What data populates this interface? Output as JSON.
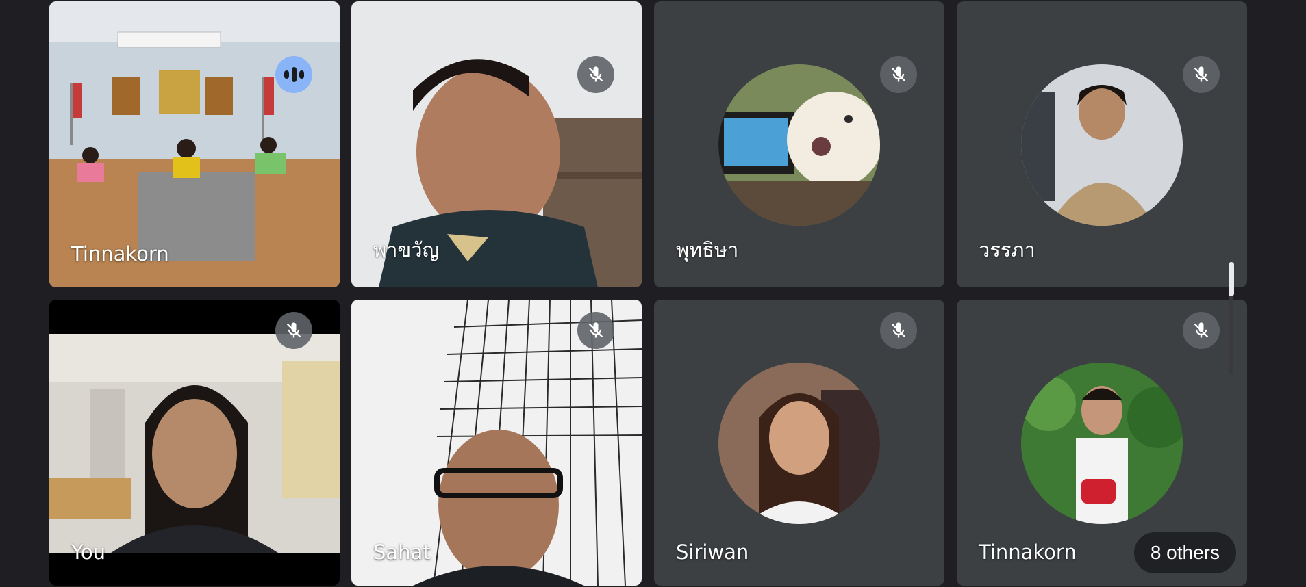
{
  "participants": [
    {
      "name": "Tinnakorn",
      "state": "speaking"
    },
    {
      "name": "พาขวัญ",
      "state": "muted"
    },
    {
      "name": "พุทธิษา",
      "state": "muted"
    },
    {
      "name": "วรรภา",
      "state": "muted"
    },
    {
      "name": "You",
      "state": "muted"
    },
    {
      "name": "Sahat",
      "state": "muted"
    },
    {
      "name": "Siriwan",
      "state": "muted"
    },
    {
      "name": "Tinnakorn",
      "state": "muted"
    }
  ],
  "others_label": "8 others",
  "icons": {
    "mic_off": "mic-off-icon",
    "speaking": "speaking-indicator-icon"
  },
  "colors": {
    "background": "#1f1f23",
    "tile": "#3c4043",
    "speaking_accent": "#8ab4f8"
  }
}
